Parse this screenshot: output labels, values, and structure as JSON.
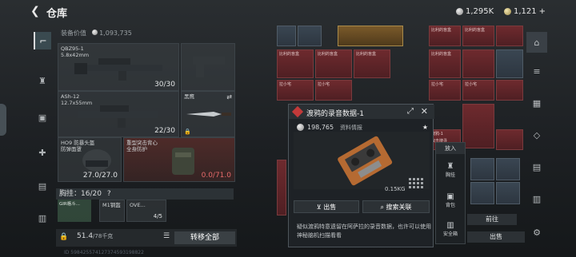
{
  "header": {
    "title": "仓库",
    "back_icon": "back-arrow-icon",
    "currency1": "1,295K",
    "currency2": "1,121",
    "currency2_plus": "+"
  },
  "equip": {
    "value_label": "装备价值",
    "value": "1,093,735",
    "slots": [
      {
        "name": "QBZ95-1",
        "ammo": "5.8x42mm",
        "count": "30/30"
      },
      {
        "name": "ASh-12",
        "ammo": "12.7x55mm",
        "count": "22/30"
      },
      {
        "name": "黑鹰",
        "ammo": "",
        "count": ""
      },
      {
        "name": "HO9 防暴头盔",
        "ammo": "防弹面罩",
        "count": "27.0/27.0"
      },
      {
        "name": "重型突击背心",
        "ammo": "全身防护",
        "count": "0.0/71.0"
      }
    ]
  },
  "chest": {
    "label": "胸挂",
    "count": "16/20",
    "help": "?"
  },
  "chest_items": [
    {
      "name": "GIR格斗..."
    },
    {
      "name": "M1钢盔"
    },
    {
      "name": "OVE..."
    }
  ],
  "chest_mini_count": "4/5",
  "weight": {
    "value": "51.4",
    "max": "/78千克"
  },
  "transfer_all": "转移全部",
  "grid": {
    "labels": [
      "比利的盲盒",
      "比利的盲盒",
      "比利的盲盒",
      "比利的盲盒",
      "比利的盲盒",
      "比利的盲盒",
      "拉小宅",
      "拉小宅",
      "拉小宅",
      "拉小宅",
      "渡鸦-1",
      "双击搜寻"
    ]
  },
  "popup": {
    "title": "渡鸦的录音数据-1",
    "price": "198,765",
    "info_label": "资料情报",
    "weight": "0.15KG",
    "sell": "出售",
    "search_related": "搜索关联",
    "description": "疑似渡鸦特意遗留在阿萨拉的录音数据，也许可以使用神秘脑机扫描看看"
  },
  "sidemenu": {
    "title": "放入",
    "items": [
      "胸挂",
      "背包",
      "安全箱"
    ]
  },
  "bottom": {
    "goto": "前往",
    "sell": "出售"
  },
  "footer": "ID 598425574127374593198822"
}
